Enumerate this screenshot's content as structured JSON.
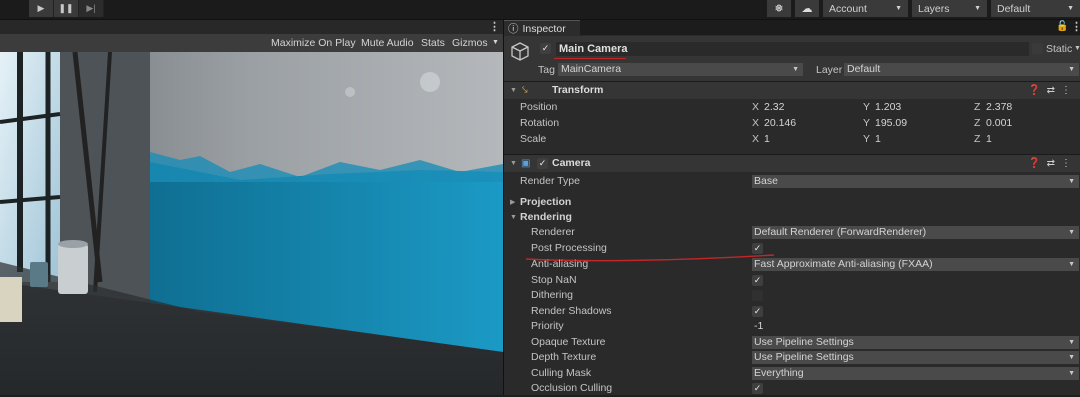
{
  "toolbar": {
    "account_label": "Account",
    "layers_label": "Layers",
    "layout_label": "Default"
  },
  "game": {
    "maximize_label": "Maximize On Play",
    "mute_label": "Mute Audio",
    "stats_label": "Stats",
    "gizmos_label": "Gizmos"
  },
  "inspector": {
    "tab_label": "Inspector",
    "object_name": "Main Camera",
    "static_label": "Static",
    "tag_label": "Tag",
    "tag_value": "MainCamera",
    "layer_label": "Layer",
    "layer_value": "Default"
  },
  "transform": {
    "title": "Transform",
    "position": {
      "label": "Position",
      "x": "2.32",
      "y": "1.203",
      "z": "2.378"
    },
    "rotation": {
      "label": "Rotation",
      "x": "20.146",
      "y": "195.09",
      "z": "0.001"
    },
    "scale": {
      "label": "Scale",
      "x": "1",
      "y": "1",
      "z": "1"
    },
    "axis_x": "X",
    "axis_y": "Y",
    "axis_z": "Z"
  },
  "camera": {
    "title": "Camera",
    "render_type_label": "Render Type",
    "render_type_value": "Base",
    "projection_label": "Projection",
    "rendering_label": "Rendering",
    "renderer_label": "Renderer",
    "renderer_value": "Default Renderer (ForwardRenderer)",
    "post_processing_label": "Post Processing",
    "post_processing": true,
    "anti_aliasing_label": "Anti-aliasing",
    "anti_aliasing_value": "Fast Approximate Anti-aliasing (FXAA)",
    "stop_nan_label": "Stop NaN",
    "stop_nan": true,
    "dithering_label": "Dithering",
    "dithering": false,
    "render_shadows_label": "Render Shadows",
    "render_shadows": true,
    "priority_label": "Priority",
    "priority_value": "-1",
    "opaque_texture_label": "Opaque Texture",
    "opaque_texture_value": "Use Pipeline Settings",
    "depth_texture_label": "Depth Texture",
    "depth_texture_value": "Use Pipeline Settings",
    "culling_mask_label": "Culling Mask",
    "culling_mask_value": "Everything",
    "occlusion_culling_label": "Occlusion Culling",
    "occlusion_culling": true
  },
  "colors": {
    "annotation": "#c02828",
    "panel_bg": "#2a2a2a",
    "header_bg": "#353535"
  }
}
